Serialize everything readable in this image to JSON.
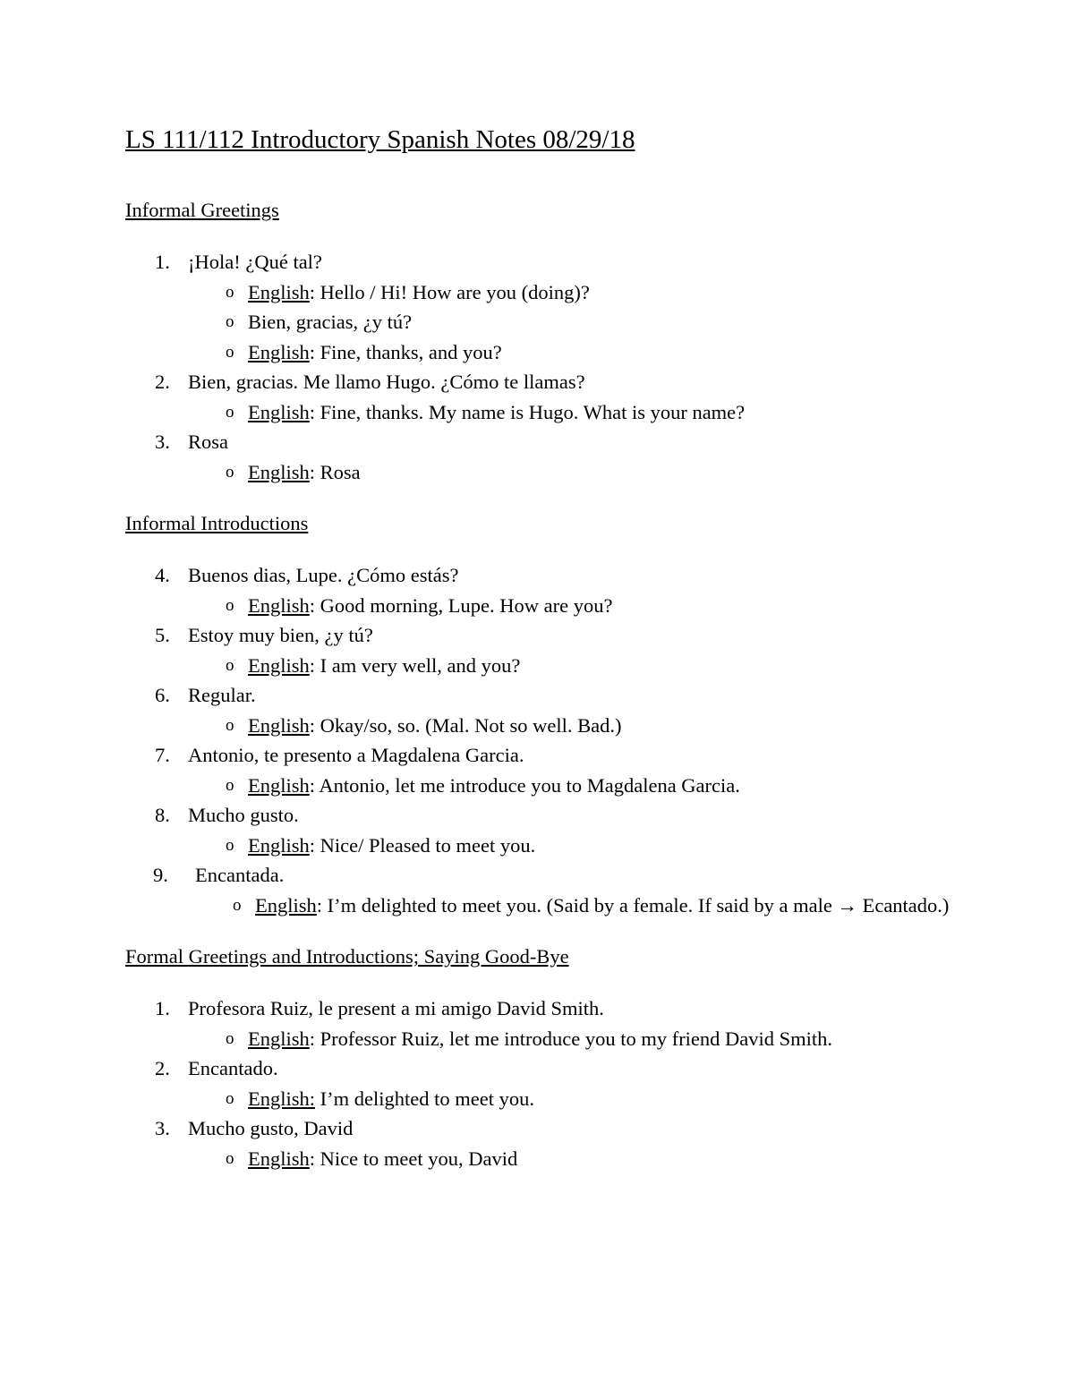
{
  "document": {
    "title": "LS 111/112 Introductory Spanish Notes 08/29/18",
    "english_label": "English",
    "colon": ":",
    "bullet_glyph": "o",
    "arrow_glyph": "→",
    "sections": [
      {
        "heading": "Informal Greetings",
        "items": [
          {
            "number": "1.",
            "text": "¡Hola! ¿Qué tal?",
            "subs": [
              {
                "label": "English",
                "labeled": true,
                "text": ": Hello / Hi! How are you (doing)?"
              },
              {
                "label": "",
                "labeled": false,
                "text": "Bien, gracias, ¿y tú?"
              },
              {
                "label": "English",
                "labeled": true,
                "text": ": Fine, thanks, and you?"
              }
            ]
          },
          {
            "number": "2.",
            "text": "Bien, gracias. Me llamo Hugo. ¿Cómo te llamas?",
            "subs": [
              {
                "label": "English",
                "labeled": true,
                "text": ": Fine, thanks. My name is Hugo. What is your name?"
              }
            ]
          },
          {
            "number": "3.",
            "text": "Rosa",
            "subs": [
              {
                "label": "English",
                "labeled": true,
                "text": ": Rosa"
              }
            ]
          }
        ]
      },
      {
        "heading": "Informal Introductions",
        "items": [
          {
            "number": "4.",
            "text": "Buenos dias, Lupe. ¿Cómo estás?",
            "subs": [
              {
                "label": "English",
                "labeled": true,
                "text": ": Good morning, Lupe. How are you?"
              }
            ]
          },
          {
            "number": "5.",
            "text": "Estoy muy bien, ¿y tú?",
            "subs": [
              {
                "label": "English",
                "labeled": true,
                "text": ": I am very well, and you?"
              }
            ]
          },
          {
            "number": "6.",
            "text": "Regular.",
            "subs": [
              {
                "label": "English",
                "labeled": true,
                "text": ": Okay/so, so. (Mal. Not so well. Bad.)"
              }
            ]
          },
          {
            "number": "7.",
            "text": "Antonio, te presento a Magdalena Garcia.",
            "subs": [
              {
                "label": "English",
                "labeled": true,
                "text": ": Antonio, let me introduce you to Magdalena Garcia."
              }
            ]
          },
          {
            "number": "8.",
            "text": "Mucho gusto.",
            "subs": [
              {
                "label": "English",
                "labeled": true,
                "text": ": Nice/ Pleased to meet you."
              }
            ]
          },
          {
            "number": "9.",
            "text": "Encantada.",
            "extra_indent": true,
            "subs": [
              {
                "label": "English",
                "labeled": true,
                "text": ": I’m delighted to meet you. (Said by a female. If said by a male → Ecantado.)"
              }
            ]
          }
        ]
      },
      {
        "heading": "Formal Greetings and Introductions; Saying Good-Bye",
        "items": [
          {
            "number": "1.",
            "text": "Profesora Ruiz, le present a mi amigo David Smith.",
            "subs": [
              {
                "label": "English",
                "labeled": true,
                "text": ": Professor Ruiz, let me introduce you to my friend David Smith."
              }
            ]
          },
          {
            "number": "2.",
            "text": "Encantado.",
            "subs": [
              {
                "label": "English:",
                "labeled": true,
                "underline_colon": true,
                "text": " I’m delighted to meet you."
              }
            ]
          },
          {
            "number": "3.",
            "text": "Mucho gusto, David",
            "subs": [
              {
                "label": "English",
                "labeled": true,
                "text": ": Nice to meet you, David"
              }
            ]
          }
        ]
      }
    ]
  }
}
